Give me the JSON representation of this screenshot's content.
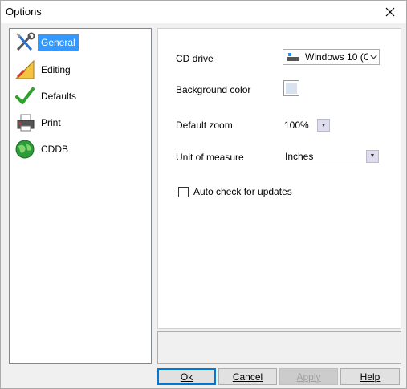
{
  "window": {
    "title": "Options"
  },
  "nav": {
    "items": [
      {
        "label": "General",
        "icon": "wrench-screwdriver-icon"
      },
      {
        "label": "Editing",
        "icon": "ruler-pencil-icon"
      },
      {
        "label": "Defaults",
        "icon": "checkmark-icon"
      },
      {
        "label": "Print",
        "icon": "printer-icon"
      },
      {
        "label": "CDDB",
        "icon": "globe-icon"
      }
    ],
    "selected": "General"
  },
  "general": {
    "cd_drive_label": "CD drive",
    "cd_drive_value": "Windows 10 (C",
    "background_color_label": "Background color",
    "background_color_value": "#d9e3f0",
    "default_zoom_label": "Default zoom",
    "default_zoom_value": "100%",
    "unit_label": "Unit of measure",
    "unit_value": "Inches",
    "auto_check_label": "Auto check for updates",
    "auto_check_checked": false
  },
  "buttons": {
    "ok": "Ok",
    "cancel": "Cancel",
    "apply": "Apply",
    "help": "Help"
  }
}
